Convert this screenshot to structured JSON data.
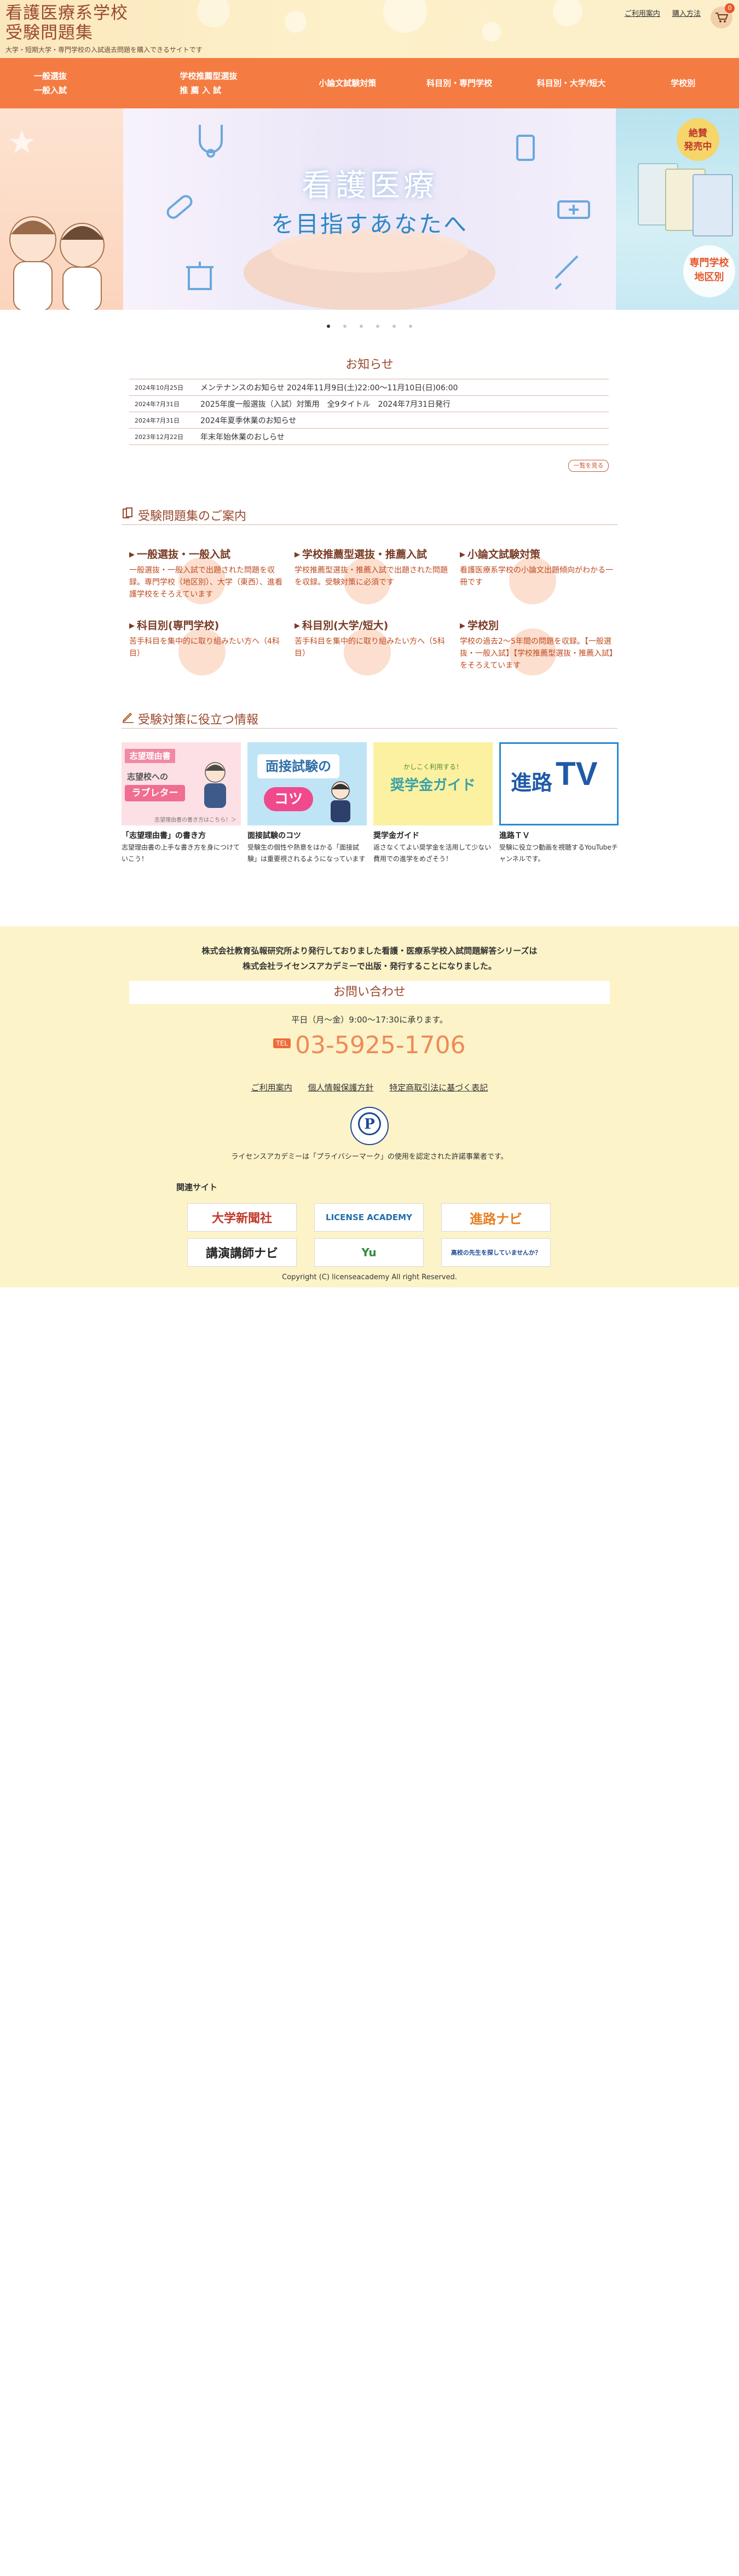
{
  "header": {
    "title_line1": "看護医療系学校",
    "title_line2": "受験問題集",
    "subtitle": "大学・短期大学・専門学校の入試過去問題を購入できるサイトです",
    "links": [
      "ご利用案内",
      "購入方法"
    ],
    "cart_count": "0"
  },
  "nav": {
    "items": [
      "一般選抜\n一般入試",
      "学校推薦型選抜\n推 薦 入 試",
      "小論文試験対策",
      "科目別・専門学校",
      "科目別・大学/短大",
      "学校別"
    ]
  },
  "hero": {
    "caption_line1": "看護医療",
    "caption_line2": "を目指すあなたへ",
    "badge": "絶賛\n発売中",
    "right_label": "専門学校\n地区別",
    "slide_count": 6,
    "active_slide": 0
  },
  "notices": {
    "title": "お知らせ",
    "items": [
      {
        "date": "2024年10月25日",
        "text": "メンテナンスのお知らせ 2024年11月9日(土)22:00〜11月10日(日)06:00"
      },
      {
        "date": "2024年7月31日",
        "text": "2025年度一般選抜（入試）対策用　全9タイトル　2024年7月31日発行"
      },
      {
        "date": "2024年7月31日",
        "text": "2024年夏季休業のお知らせ"
      },
      {
        "date": "2023年12月22日",
        "text": "年末年始休業のおしらせ"
      }
    ],
    "more_label": "一覧を見る"
  },
  "guide": {
    "heading": "受験問題集のご案内",
    "items": [
      {
        "title": "一般選抜・一般入試",
        "desc": "一般選抜・一般入試で出題された問題を収録。専門学校（地区別）、大学（東西）、進看護学校をそろえています"
      },
      {
        "title": "学校推薦型選抜・推薦入試",
        "desc": "学校推薦型選抜・推薦入試で出題された問題を収録。受験対策に必須です"
      },
      {
        "title": "小論文試験対策",
        "desc": "看護医療系学校の小論文出題傾向がわかる一冊です"
      },
      {
        "title": "科目別(専門学校)",
        "desc": "苦手科目を集中的に取り組みたい方へ（4科目）"
      },
      {
        "title": "科目別(大学/短大)",
        "desc": "苦手科目を集中的に取り組みたい方へ（5科目）"
      },
      {
        "title": "学校別",
        "desc": "学校の過去2〜5年間の問題を収録。【一般選抜・一般入試】【学校推薦型選抜・推薦入試】をそろえています"
      }
    ]
  },
  "info": {
    "heading": "受験対策に役立つ情報",
    "cards": [
      {
        "title": "「志望理由書」の書き方",
        "desc": "志望理由書の上手な書き方を身につけていこう！",
        "img_text_1": "志望理由書",
        "img_text_2": "志望校への",
        "img_text_3": "ラブレター",
        "img_caption": "志望理由書の書き方はこちら！＞"
      },
      {
        "title": "面接試験のコツ",
        "desc": "受験生の個性や熱意をはかる「面接試験」は重要視されるようになっています",
        "img_text_1": "面接試験の",
        "img_text_2": "コツ"
      },
      {
        "title": "奨学金ガイド",
        "desc": "返さなくてよい奨学金を活用して少ない費用での進学をめざそう！",
        "img_text_1": "かしこく利用する！",
        "img_text_2": "奨学金ガイド"
      },
      {
        "title": "進路ＴＶ",
        "desc": "受験に役立つ動画を視聴するYouTubeチャンネルです。",
        "img_text_1": "進路",
        "img_text_2": "TV"
      }
    ]
  },
  "footer": {
    "note_line1": "株式会社教育弘報研究所より発行しておりました看護・医療系学校入試問題解答シリーズは",
    "note_line2": "株式会社ライセンスアカデミーで出版・発行することになりました。",
    "contact_title": "お問い合わせ",
    "hours": "平日（月〜金）9:00〜17:30に承ります。",
    "tel_label": "TEL",
    "phone": "03-5925-1706",
    "links": [
      "ご利用案内",
      "個人情報保護方針",
      "特定商取引法に基づく表記"
    ],
    "pmark_symbol": "P",
    "pmark_text": "ライセンスアカデミーは「プライバシーマーク」の使用を認定された許諾事業者です。",
    "related_title": "関連サイト",
    "banners": [
      {
        "label": "大学新聞社",
        "color": "#c0392b"
      },
      {
        "label": "LICENSE ACADEMY",
        "color": "#1f6fa8"
      },
      {
        "label": "進路ナビ",
        "color": "#e67e22"
      },
      {
        "label": "講演講師ナビ",
        "color": "#222222"
      },
      {
        "label": "Yu",
        "color": "#2e8b3e"
      },
      {
        "label": "高校の先生を探していませんか？",
        "color": "#1f4a8f"
      }
    ],
    "copyright": "Copyright (C) licenseacademy All right Reserved."
  },
  "colors": {
    "accent": "#f47c42",
    "title_brown": "#9a4a2e",
    "footer_bg": "#fdf3c9",
    "phone_orange": "#ef8a57"
  }
}
